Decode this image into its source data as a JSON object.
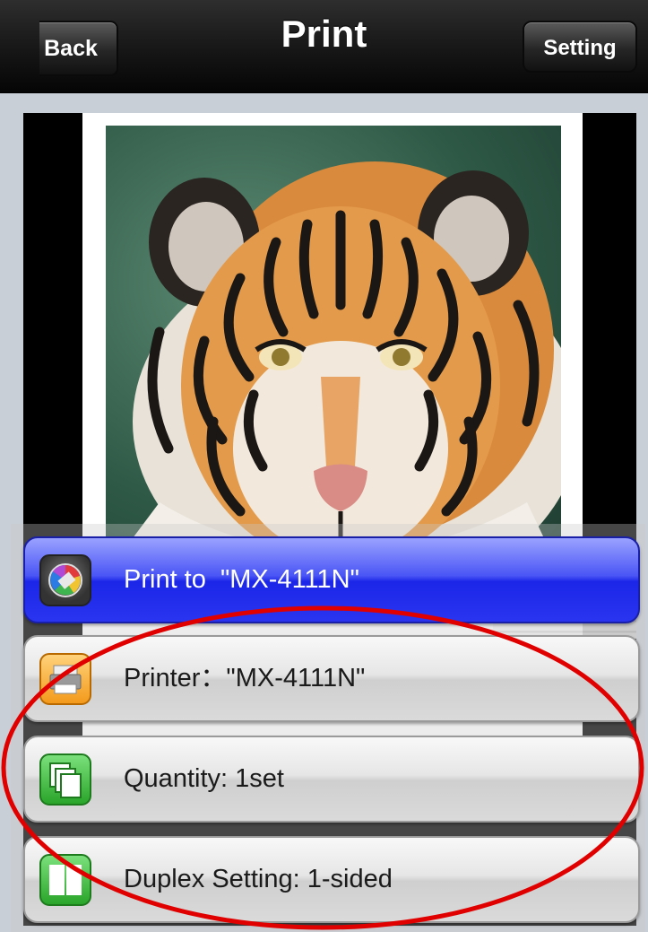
{
  "navbar": {
    "title": "Print",
    "back_label": "Back",
    "setting_label": "Setting"
  },
  "preview": {
    "photo_subject": "tiger-photo"
  },
  "menu": {
    "items": [
      {
        "label": "Print to  \"MX-4111N\"",
        "icon": "print-icon",
        "style": "primary"
      },
      {
        "label": "Printer：\"MX-4111N\"",
        "icon": "printer-icon",
        "style": "normal"
      },
      {
        "label": "Quantity: 1set",
        "icon": "quantity-icon",
        "style": "normal"
      },
      {
        "label": "Duplex Setting: 1-sided",
        "icon": "duplex-icon",
        "style": "normal"
      }
    ]
  },
  "colors": {
    "primary_button": "#1b26e8",
    "annotation_ellipse": "#e00000",
    "navbar": "#111111"
  }
}
